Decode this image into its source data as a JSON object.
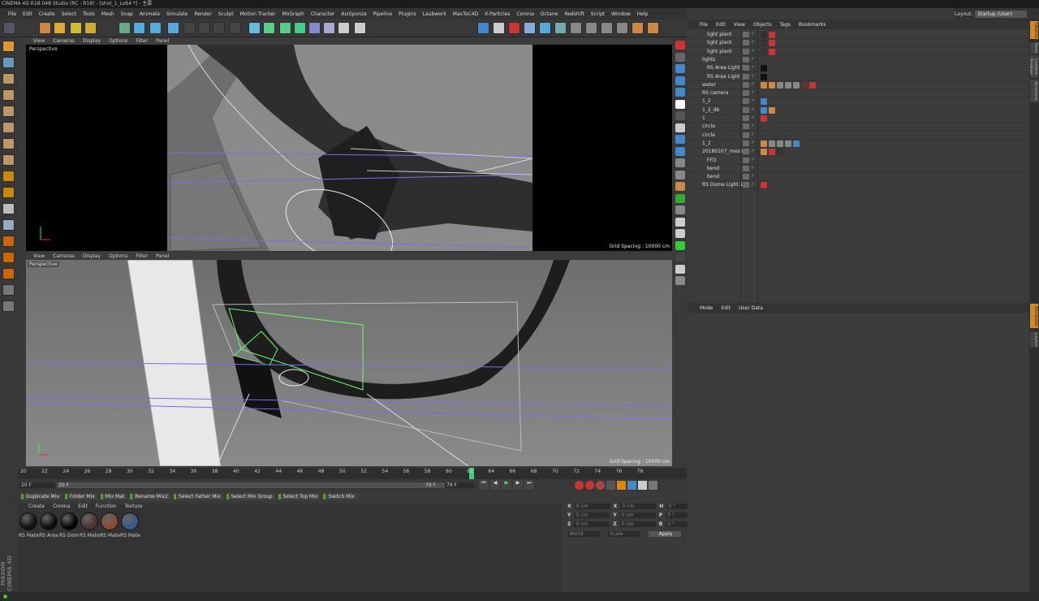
{
  "title": "CINEMA 4D R18.048 Studio (RC - R18) - [shot_1_Lo64 *] - 主要",
  "menu": [
    "File",
    "Edit",
    "Create",
    "Select",
    "Tools",
    "Mesh",
    "Snap",
    "Animate",
    "Simulate",
    "Render",
    "Sculpt",
    "Motion Tracker",
    "MoGraph",
    "Character",
    "AixSponza",
    "Pipeline",
    "Plugins",
    "Laubwerk",
    "MaxToC4D",
    "X-Particles",
    "Corona",
    "Octane",
    "Redshift",
    "Script",
    "Window",
    "Help"
  ],
  "layout": {
    "label": "Layout:",
    "value": "Startup (User)"
  },
  "viewport_menu": [
    "View",
    "Cameras",
    "Display",
    "Options",
    "Filter",
    "Panel"
  ],
  "viewport1": {
    "label": "Perspective",
    "grid": "Grid Spacing : 10000 cm"
  },
  "viewport2": {
    "label": "Perspective",
    "grid": "Grid Spacing : 10000 cm"
  },
  "timeline_ticks": [
    "20",
    "22",
    "24",
    "26",
    "28",
    "30",
    "32",
    "34",
    "36",
    "38",
    "40",
    "42",
    "44",
    "46",
    "48",
    "50",
    "52",
    "54",
    "56",
    "58",
    "60",
    "62",
    "64",
    "66",
    "68",
    "70",
    "72",
    "74",
    "76",
    "78"
  ],
  "timeline_current": "62",
  "frame": {
    "start": "20 F",
    "start2": "20 F",
    "end": "79 F",
    "end2": "79 F",
    "end_label": "79 F"
  },
  "mix_buttons": [
    "Duplicate Mix",
    "Folder Mix",
    "Mix Mat",
    "Rename Mix2",
    "Select Father Mix",
    "Select Mix Group",
    "Select Top Mix",
    "Switch Mix"
  ],
  "material_menu": [
    "Create",
    "Corona",
    "Edit",
    "Function",
    "Texture"
  ],
  "materials": [
    {
      "label": "RS Mate",
      "color": "#111111"
    },
    {
      "label": "RS Area",
      "color": "#0d0d0d"
    },
    {
      "label": "RS Dom",
      "color": "#050505"
    },
    {
      "label": "RS Mate",
      "color": "#4a3530"
    },
    {
      "label": "RS Mate",
      "color": "#8a4a30"
    },
    {
      "label": "RS Mate",
      "color": "#3a5a8a"
    }
  ],
  "coords": {
    "rows": [
      {
        "a": "X",
        "av": "0 cm",
        "b": "X",
        "bv": "0 cm",
        "c": "H",
        "cv": "0 °"
      },
      {
        "a": "Y",
        "av": "0 cm",
        "b": "Y",
        "bv": "0 cm",
        "c": "P",
        "cv": "0 °"
      },
      {
        "a": "Z",
        "av": "0 cm",
        "b": "Z",
        "bv": "0 cm",
        "c": "B",
        "cv": "0 °"
      }
    ],
    "world": "World",
    "scale": "Scale",
    "apply": "Apply"
  },
  "object_menu": [
    "File",
    "Edit",
    "View",
    "Objects",
    "Tags",
    "Bookmarks"
  ],
  "objects": [
    {
      "name": "light plant",
      "indent": 1
    },
    {
      "name": "light plant",
      "indent": 1
    },
    {
      "name": "light plant",
      "indent": 1
    },
    {
      "name": "lights",
      "indent": 0
    },
    {
      "name": "RS Area Light.1",
      "indent": 1
    },
    {
      "name": "RS Area Light",
      "indent": 1
    },
    {
      "name": "water",
      "indent": 0
    },
    {
      "name": "RS camera",
      "indent": 0
    },
    {
      "name": "1_2",
      "indent": 0
    },
    {
      "name": "1_2_db",
      "indent": 0
    },
    {
      "name": "1",
      "indent": 0
    },
    {
      "name": "circle",
      "indent": 0
    },
    {
      "name": "circle",
      "indent": 0
    },
    {
      "name": "1_2",
      "indent": 0
    },
    {
      "name": "20180107_mesh",
      "indent": 0
    },
    {
      "name": "FFD",
      "indent": 1
    },
    {
      "name": "bend",
      "indent": 1
    },
    {
      "name": "bend",
      "indent": 1
    },
    {
      "name": "RS Dome Light.1",
      "indent": 0
    }
  ],
  "attr_menu": [
    "Mode",
    "Edit",
    "User Data"
  ],
  "side_tabs": [
    "Objects",
    "Takes",
    "Content Browser",
    "Structure",
    "Attributes",
    "Layers"
  ],
  "brand": "MAXON CINEMA 4D"
}
